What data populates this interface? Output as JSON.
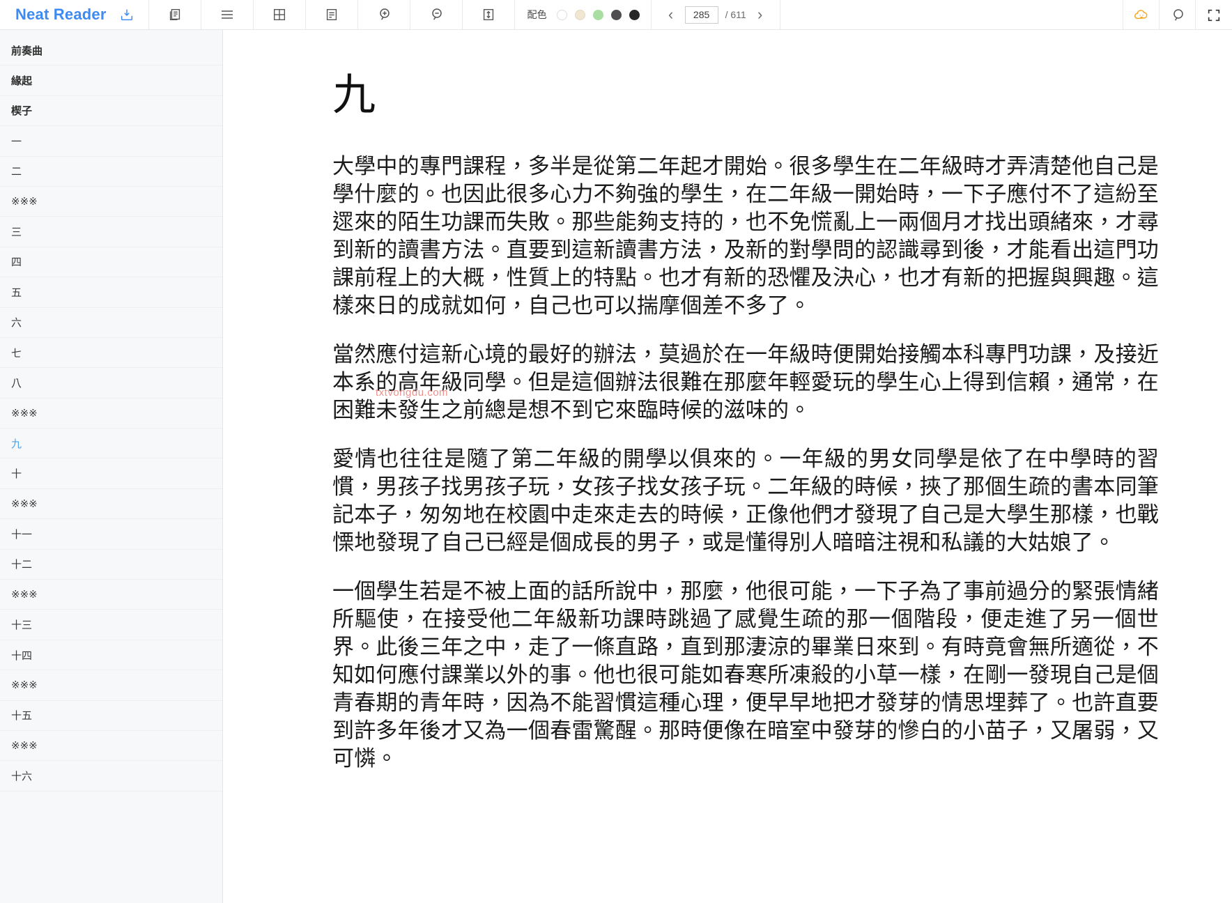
{
  "app": {
    "brand": "Neat Reader"
  },
  "toolbar": {
    "icons": [
      {
        "name": "library-save-icon",
        "label": "Save to library"
      },
      {
        "name": "copy-pages-icon",
        "label": "Two page view"
      },
      {
        "name": "contents-list-icon",
        "label": "Table of contents"
      },
      {
        "name": "grid-layout-icon",
        "label": "Grid layout"
      },
      {
        "name": "notes-icon",
        "label": "Notes"
      },
      {
        "name": "zoom-in-icon",
        "label": "Increase font size"
      },
      {
        "name": "zoom-out-icon",
        "label": "Decrease font size"
      },
      {
        "name": "line-height-icon",
        "label": "Line spacing"
      }
    ],
    "scheme": {
      "label": "配色",
      "swatches": [
        {
          "name": "scheme-white",
          "color": "#ffffff",
          "selected": false
        },
        {
          "name": "scheme-sepia",
          "color": "#f0e6d2",
          "selected": false
        },
        {
          "name": "scheme-green",
          "color": "#a8dfa0",
          "selected": false
        },
        {
          "name": "scheme-dark-gray",
          "color": "#4f4f4f",
          "selected": false
        },
        {
          "name": "scheme-black",
          "color": "#262626",
          "selected": false
        }
      ]
    },
    "pager": {
      "prev_label": "‹",
      "next_label": "›",
      "current_page": "285",
      "page_placeholder": "285",
      "total_label": "/ 611"
    },
    "right_icons": [
      {
        "name": "cloud-sync-icon",
        "label": "Cloud sync",
        "color": "#f5a623"
      },
      {
        "name": "search-icon",
        "label": "Search"
      },
      {
        "name": "fullscreen-icon",
        "label": "Fullscreen"
      }
    ]
  },
  "sidebar": {
    "items": [
      {
        "label": "前奏曲",
        "bold": true,
        "active": false
      },
      {
        "label": "緣起",
        "bold": true,
        "active": false
      },
      {
        "label": "楔子",
        "bold": true,
        "active": false
      },
      {
        "label": "一",
        "bold": false,
        "active": false
      },
      {
        "label": "二",
        "bold": false,
        "active": false
      },
      {
        "label": "※※※",
        "bold": false,
        "active": false
      },
      {
        "label": "三",
        "bold": false,
        "active": false
      },
      {
        "label": "四",
        "bold": false,
        "active": false
      },
      {
        "label": "五",
        "bold": false,
        "active": false
      },
      {
        "label": "六",
        "bold": false,
        "active": false
      },
      {
        "label": "七",
        "bold": false,
        "active": false
      },
      {
        "label": "八",
        "bold": false,
        "active": false
      },
      {
        "label": "※※※",
        "bold": false,
        "active": false
      },
      {
        "label": "九",
        "bold": false,
        "active": true
      },
      {
        "label": "十",
        "bold": false,
        "active": false
      },
      {
        "label": "※※※",
        "bold": false,
        "active": false
      },
      {
        "label": "十一",
        "bold": false,
        "active": false
      },
      {
        "label": "十二",
        "bold": false,
        "active": false
      },
      {
        "label": "※※※",
        "bold": false,
        "active": false
      },
      {
        "label": "十三",
        "bold": false,
        "active": false
      },
      {
        "label": "十四",
        "bold": false,
        "active": false
      },
      {
        "label": "※※※",
        "bold": false,
        "active": false
      },
      {
        "label": "十五",
        "bold": false,
        "active": false
      },
      {
        "label": "※※※",
        "bold": false,
        "active": false
      },
      {
        "label": "十六",
        "bold": false,
        "active": false
      }
    ]
  },
  "reader": {
    "chapter_title": "九",
    "watermark": "txtvongdu.com",
    "paragraphs": [
      "大學中的專門課程，多半是從第二年起才開始。很多學生在二年級時才弄清楚他自己是學什麼的。也因此很多心力不夠強的學生，在二年級一開始時，一下子應付不了這紛至遝來的陌生功課而失敗。那些能夠支持的，也不免慌亂上一兩個月才找出頭緒來，才尋到新的讀書方法。直要到這新讀書方法，及新的對學問的認識尋到後，才能看出這門功課前程上的大概，性質上的特點。也才有新的恐懼及決心，也才有新的把握與興趣。這樣來日的成就如何，自己也可以揣摩個差不多了。",
      "當然應付這新心境的最好的辦法，莫過於在一年級時便開始接觸本科專門功課，及接近本系的高年級同學。但是這個辦法很難在那麼年輕愛玩的學生心上得到信賴，通常，在困難未發生之前總是想不到它來臨時候的滋味的。",
      "愛情也往往是隨了第二年級的開學以俱來的。一年級的男女同學是依了在中學時的習慣，男孩子找男孩子玩，女孩子找女孩子玩。二年級的時候，挾了那個生疏的書本同筆記本子，匆匆地在校園中走來走去的時候，正像他們才發現了自己是大學生那樣，也戰慄地發現了自己已經是個成長的男子，或是懂得別人暗暗注視和私議的大姑娘了。",
      "一個學生若是不被上面的話所說中，那麼，他很可能，一下子為了事前過分的緊張情緒所驅使，在接受他二年級新功課時跳過了感覺生疏的那一個階段，便走進了另一個世界。此後三年之中，走了一條直路，直到那淒涼的畢業日來到。有時竟會無所適從，不知如何應付課業以外的事。他也很可能如春寒所凍殺的小草一樣，在剛一發現自己是個青春期的青年時，因為不能習慣這種心理，便早早地把才發芽的情思埋葬了。也許直要到許多年後才又為一個春雷驚醒。那時便像在暗室中發芽的慘白的小苗子，又屠弱，又可憐。"
    ]
  }
}
